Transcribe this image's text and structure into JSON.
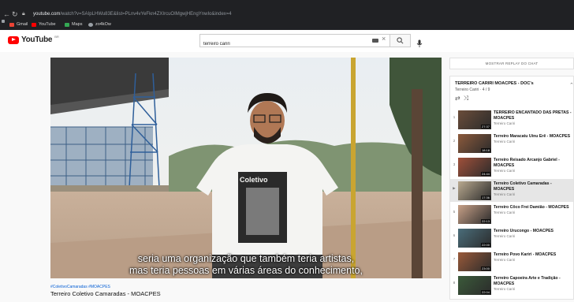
{
  "browser": {
    "url_host": "youtube.com",
    "url_rest": "/watch?v=SAIpLHWu83E&list=PLnv4vYeFkn4ZXIrcuOIMgwjHEngYnwIo&index=4",
    "bookmarks": [
      {
        "label": "Gmail",
        "color": "#ea4335"
      },
      {
        "label": "YouTube",
        "color": "#ff0000"
      },
      {
        "label": "Maps",
        "color": "#34a853"
      },
      {
        "label": "zo4kOw",
        "color": "#9aa0a6"
      }
    ]
  },
  "youtube": {
    "logo_text": "YouTube",
    "country_code": "BR",
    "search_value": "terreiro cariri"
  },
  "video": {
    "caption_line1": "seria uma organização que também teria artistas,",
    "caption_line2": "mas teria pessoas em várias áreas do conhecimento,",
    "hashtags": "#ColetivoCamaradas #MOACPES",
    "title": "Terreiro Coletivo Camaradas - MOACPES"
  },
  "chat_replay_button": "MOSTRAR REPLAY DO CHAT",
  "playlist": {
    "title": "TERREIRO CARIRI MOACPES - DOC's",
    "subtitle": "Terreiro Cariri · 4 / 9",
    "items": [
      {
        "index": "1",
        "title": "TERREIRO ENCANTADO DAS PRETAS - MOACPES",
        "channel": "Terreiro Cariri",
        "duration": "27:37",
        "thumb_color": "#6b4d3a",
        "active": false
      },
      {
        "index": "2",
        "title": "Terreiro Maracatu Uinu Erê - MOACPES",
        "channel": "Terreiro Cariri",
        "duration": "18:18",
        "thumb_color": "#8c5a3c",
        "active": false
      },
      {
        "index": "3",
        "title": "Terreiro Reisado Arcanjo Gabriel - MOACPES",
        "channel": "Terreiro Cariri",
        "duration": "24:44",
        "thumb_color": "#a0503a",
        "active": false
      },
      {
        "index": "▶",
        "title": "Terreiro Coletivo Camaradas - MOACPES",
        "channel": "Terreiro Cariri",
        "duration": "17:36",
        "thumb_color": "#b9a98f",
        "active": true
      },
      {
        "index": "5",
        "title": "Terreiro Côco Frei Damião - MOACPES",
        "channel": "Terreiro Cariri",
        "duration": "22:13",
        "thumb_color": "#c7a087",
        "active": false
      },
      {
        "index": "6",
        "title": "Terreiro Urucongo - MOACPES",
        "channel": "Terreiro Cariri",
        "duration": "22:00",
        "thumb_color": "#4a6d7a",
        "active": false
      },
      {
        "index": "7",
        "title": "Terreiro Povo Kariri - MOACPES",
        "channel": "Terreiro Cariri",
        "duration": "23:00",
        "thumb_color": "#9a5a3a",
        "active": false
      },
      {
        "index": "8",
        "title": "Terreiro Capoeira Arte e Tradição - MOACPES",
        "channel": "Terreiro Cariri",
        "duration": "22:04",
        "thumb_color": "#3b5a3a",
        "active": false
      }
    ]
  }
}
